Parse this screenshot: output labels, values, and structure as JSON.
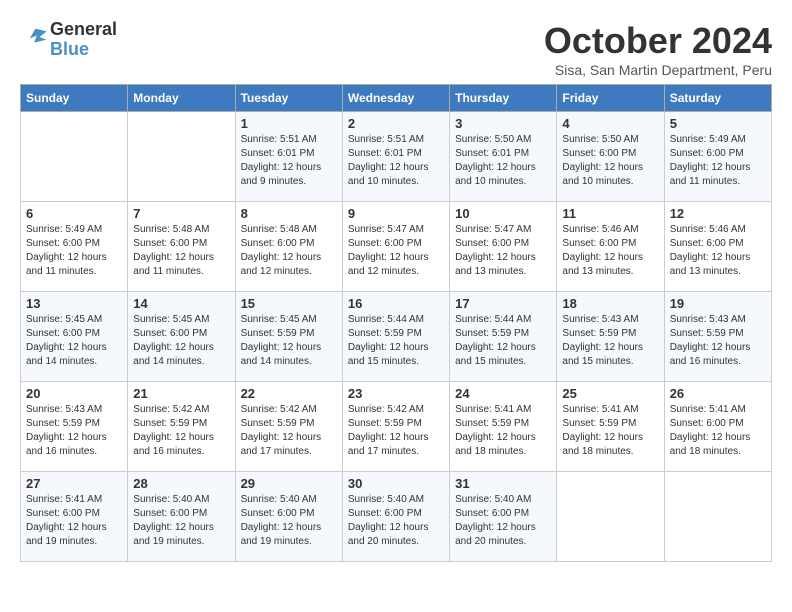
{
  "header": {
    "logo_line1": "General",
    "logo_line2": "Blue",
    "month": "October 2024",
    "location": "Sisa, San Martin Department, Peru"
  },
  "weekdays": [
    "Sunday",
    "Monday",
    "Tuesday",
    "Wednesday",
    "Thursday",
    "Friday",
    "Saturday"
  ],
  "weeks": [
    [
      {
        "day": "",
        "info": ""
      },
      {
        "day": "",
        "info": ""
      },
      {
        "day": "1",
        "info": "Sunrise: 5:51 AM\nSunset: 6:01 PM\nDaylight: 12 hours and 9 minutes."
      },
      {
        "day": "2",
        "info": "Sunrise: 5:51 AM\nSunset: 6:01 PM\nDaylight: 12 hours and 10 minutes."
      },
      {
        "day": "3",
        "info": "Sunrise: 5:50 AM\nSunset: 6:01 PM\nDaylight: 12 hours and 10 minutes."
      },
      {
        "day": "4",
        "info": "Sunrise: 5:50 AM\nSunset: 6:00 PM\nDaylight: 12 hours and 10 minutes."
      },
      {
        "day": "5",
        "info": "Sunrise: 5:49 AM\nSunset: 6:00 PM\nDaylight: 12 hours and 11 minutes."
      }
    ],
    [
      {
        "day": "6",
        "info": "Sunrise: 5:49 AM\nSunset: 6:00 PM\nDaylight: 12 hours and 11 minutes."
      },
      {
        "day": "7",
        "info": "Sunrise: 5:48 AM\nSunset: 6:00 PM\nDaylight: 12 hours and 11 minutes."
      },
      {
        "day": "8",
        "info": "Sunrise: 5:48 AM\nSunset: 6:00 PM\nDaylight: 12 hours and 12 minutes."
      },
      {
        "day": "9",
        "info": "Sunrise: 5:47 AM\nSunset: 6:00 PM\nDaylight: 12 hours and 12 minutes."
      },
      {
        "day": "10",
        "info": "Sunrise: 5:47 AM\nSunset: 6:00 PM\nDaylight: 12 hours and 13 minutes."
      },
      {
        "day": "11",
        "info": "Sunrise: 5:46 AM\nSunset: 6:00 PM\nDaylight: 12 hours and 13 minutes."
      },
      {
        "day": "12",
        "info": "Sunrise: 5:46 AM\nSunset: 6:00 PM\nDaylight: 12 hours and 13 minutes."
      }
    ],
    [
      {
        "day": "13",
        "info": "Sunrise: 5:45 AM\nSunset: 6:00 PM\nDaylight: 12 hours and 14 minutes."
      },
      {
        "day": "14",
        "info": "Sunrise: 5:45 AM\nSunset: 6:00 PM\nDaylight: 12 hours and 14 minutes."
      },
      {
        "day": "15",
        "info": "Sunrise: 5:45 AM\nSunset: 5:59 PM\nDaylight: 12 hours and 14 minutes."
      },
      {
        "day": "16",
        "info": "Sunrise: 5:44 AM\nSunset: 5:59 PM\nDaylight: 12 hours and 15 minutes."
      },
      {
        "day": "17",
        "info": "Sunrise: 5:44 AM\nSunset: 5:59 PM\nDaylight: 12 hours and 15 minutes."
      },
      {
        "day": "18",
        "info": "Sunrise: 5:43 AM\nSunset: 5:59 PM\nDaylight: 12 hours and 15 minutes."
      },
      {
        "day": "19",
        "info": "Sunrise: 5:43 AM\nSunset: 5:59 PM\nDaylight: 12 hours and 16 minutes."
      }
    ],
    [
      {
        "day": "20",
        "info": "Sunrise: 5:43 AM\nSunset: 5:59 PM\nDaylight: 12 hours and 16 minutes."
      },
      {
        "day": "21",
        "info": "Sunrise: 5:42 AM\nSunset: 5:59 PM\nDaylight: 12 hours and 16 minutes."
      },
      {
        "day": "22",
        "info": "Sunrise: 5:42 AM\nSunset: 5:59 PM\nDaylight: 12 hours and 17 minutes."
      },
      {
        "day": "23",
        "info": "Sunrise: 5:42 AM\nSunset: 5:59 PM\nDaylight: 12 hours and 17 minutes."
      },
      {
        "day": "24",
        "info": "Sunrise: 5:41 AM\nSunset: 5:59 PM\nDaylight: 12 hours and 18 minutes."
      },
      {
        "day": "25",
        "info": "Sunrise: 5:41 AM\nSunset: 5:59 PM\nDaylight: 12 hours and 18 minutes."
      },
      {
        "day": "26",
        "info": "Sunrise: 5:41 AM\nSunset: 6:00 PM\nDaylight: 12 hours and 18 minutes."
      }
    ],
    [
      {
        "day": "27",
        "info": "Sunrise: 5:41 AM\nSunset: 6:00 PM\nDaylight: 12 hours and 19 minutes."
      },
      {
        "day": "28",
        "info": "Sunrise: 5:40 AM\nSunset: 6:00 PM\nDaylight: 12 hours and 19 minutes."
      },
      {
        "day": "29",
        "info": "Sunrise: 5:40 AM\nSunset: 6:00 PM\nDaylight: 12 hours and 19 minutes."
      },
      {
        "day": "30",
        "info": "Sunrise: 5:40 AM\nSunset: 6:00 PM\nDaylight: 12 hours and 20 minutes."
      },
      {
        "day": "31",
        "info": "Sunrise: 5:40 AM\nSunset: 6:00 PM\nDaylight: 12 hours and 20 minutes."
      },
      {
        "day": "",
        "info": ""
      },
      {
        "day": "",
        "info": ""
      }
    ]
  ]
}
